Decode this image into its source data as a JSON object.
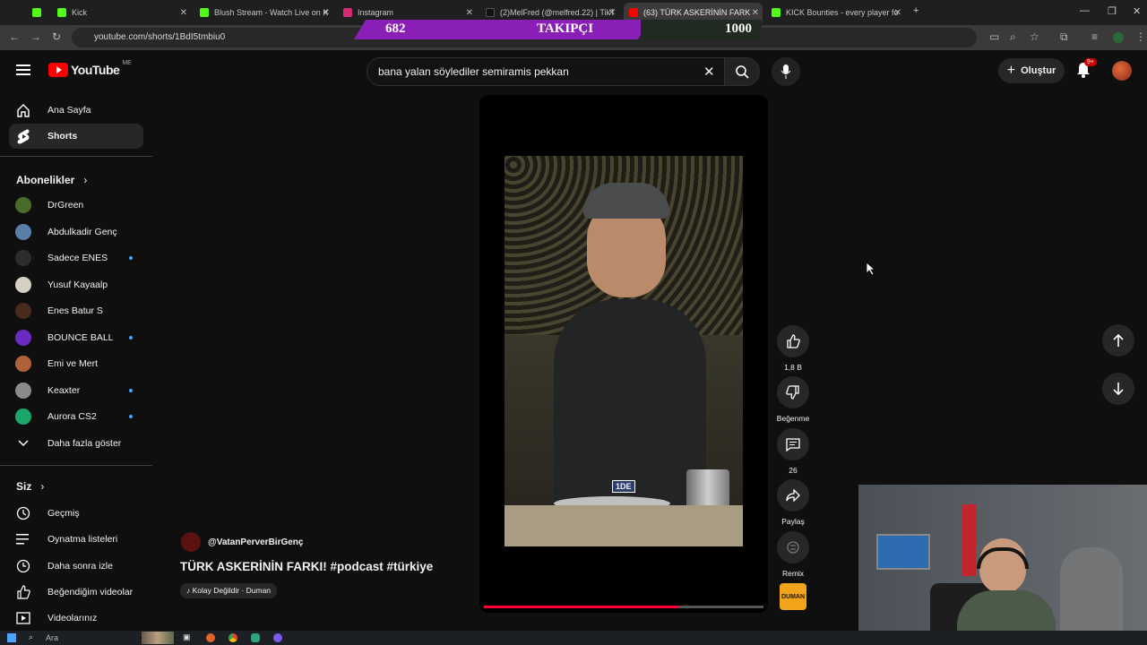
{
  "browser": {
    "tabs": [
      {
        "label": "",
        "color": "#53fc18"
      },
      {
        "label": "Kick",
        "color": "#53fc18"
      },
      {
        "label": "Blush Stream - Watch Live on K",
        "color": "#53fc18"
      },
      {
        "label": "Instagram",
        "color": "#d62976"
      },
      {
        "label": "(2)MelFred (@melfred.22) | TikT",
        "color": "#111111"
      },
      {
        "label": "(63) TÜRK ASKERİNİN FARK",
        "color": "#ff0000"
      },
      {
        "label": "KICK Bounties - every player fo",
        "color": "#53fc18"
      }
    ],
    "url": "youtube.com/shorts/1BdI5tmbiu0"
  },
  "overlay": {
    "count": "682",
    "label": "TAKIPÇI",
    "goal": "1000"
  },
  "header": {
    "logo_text": "YouTube",
    "country": "ME",
    "search_value": "bana yalan söylediler semiramis pekkan",
    "create_label": "Oluştur",
    "notif_count": "9+"
  },
  "sidebar": {
    "nav": [
      {
        "label": "Ana Sayfa",
        "icon": "home-icon"
      },
      {
        "label": "Shorts",
        "icon": "shorts-icon"
      }
    ],
    "subs_title": "Abonelikler",
    "subs": [
      {
        "label": "DrGreen",
        "color": "#4a6b2a",
        "dot": false
      },
      {
        "label": "Abdulkadir Genç",
        "color": "#5a7ea8",
        "dot": false
      },
      {
        "label": "Sadece ENES",
        "color": "#2c2c2c",
        "dot": true
      },
      {
        "label": "Yusuf Kayaalp",
        "color": "#d6d0c4",
        "dot": false
      },
      {
        "label": "Enes Batur S",
        "color": "#4a2a1f",
        "dot": false
      },
      {
        "label": "BOUNCE BALL",
        "color": "#6a2bc2",
        "dot": true
      },
      {
        "label": "Emi ve Mert",
        "color": "#b0603a",
        "dot": false
      },
      {
        "label": "Keaxter",
        "color": "#8a8a8a",
        "dot": true
      },
      {
        "label": "Aurora CS2",
        "color": "#1aa86a",
        "dot": true
      }
    ],
    "more_label": "Daha fazla göster",
    "you_title": "Siz",
    "you_items": [
      {
        "label": "Geçmiş",
        "icon": "history-icon"
      },
      {
        "label": "Oynatma listeleri",
        "icon": "playlist-icon"
      },
      {
        "label": "Daha sonra izle",
        "icon": "clock-icon"
      },
      {
        "label": "Beğendiğim videolar",
        "icon": "like-icon"
      },
      {
        "label": "Videolarınız",
        "icon": "video-icon"
      }
    ]
  },
  "video": {
    "caption": "1DE",
    "progress": 0.7,
    "channel": "@VatanPerverBirGenç",
    "title": "TÜRK ASKERİNİN FARKI! #podcast #türkiye",
    "music": "Kolay Değildir · Duman"
  },
  "actions": {
    "likes": "1,8 B",
    "dislike_label": "Beğenme",
    "comments": "26",
    "share_label": "Paylaş",
    "remix_label": "Remix",
    "sound_label": "DUMAN"
  },
  "taskbar": {
    "search_placeholder": "Ara"
  }
}
